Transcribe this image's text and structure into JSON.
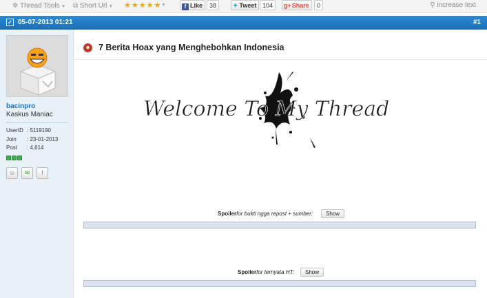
{
  "toolbar": {
    "thread_tools": "Thread Tools",
    "short_url": "Short Url",
    "stars": "★★★★★",
    "like_label": "Like",
    "like_count": "38",
    "tweet_label": "Tweet",
    "tweet_count": "104",
    "share_label": "Share",
    "share_count": "0",
    "increase_text": "increase text"
  },
  "post": {
    "date": "05-07-2013 01:21",
    "number": "#1",
    "title": "7 Berita Hoax yang Menghebohkan Indonesia"
  },
  "user": {
    "name": "bacinpro",
    "title": "Kaskus Maniac",
    "stats": [
      {
        "key": "UserID",
        "value": ": 5119190"
      },
      {
        "key": "Join",
        "value": ": 23-01-2013"
      },
      {
        "key": "Post",
        "value": ": 4,614"
      }
    ],
    "reputation_boxes": 3
  },
  "banner": {
    "text": "Welcome To My Thread"
  },
  "spoilers": [
    {
      "label": "Spoiler",
      "for_text": "for bukti ngga repost + sumber:",
      "button": "Show"
    },
    {
      "label": "Spoiler",
      "for_text": "for ternyata HT:",
      "button": "Show"
    }
  ],
  "icons": {
    "thread_tools": "gear-icon",
    "short_url": "link-icon",
    "increase_text": "magnifier-icon",
    "facebook": "facebook-icon",
    "twitter": "twitter-icon",
    "googleplus": "gplus-icon"
  }
}
